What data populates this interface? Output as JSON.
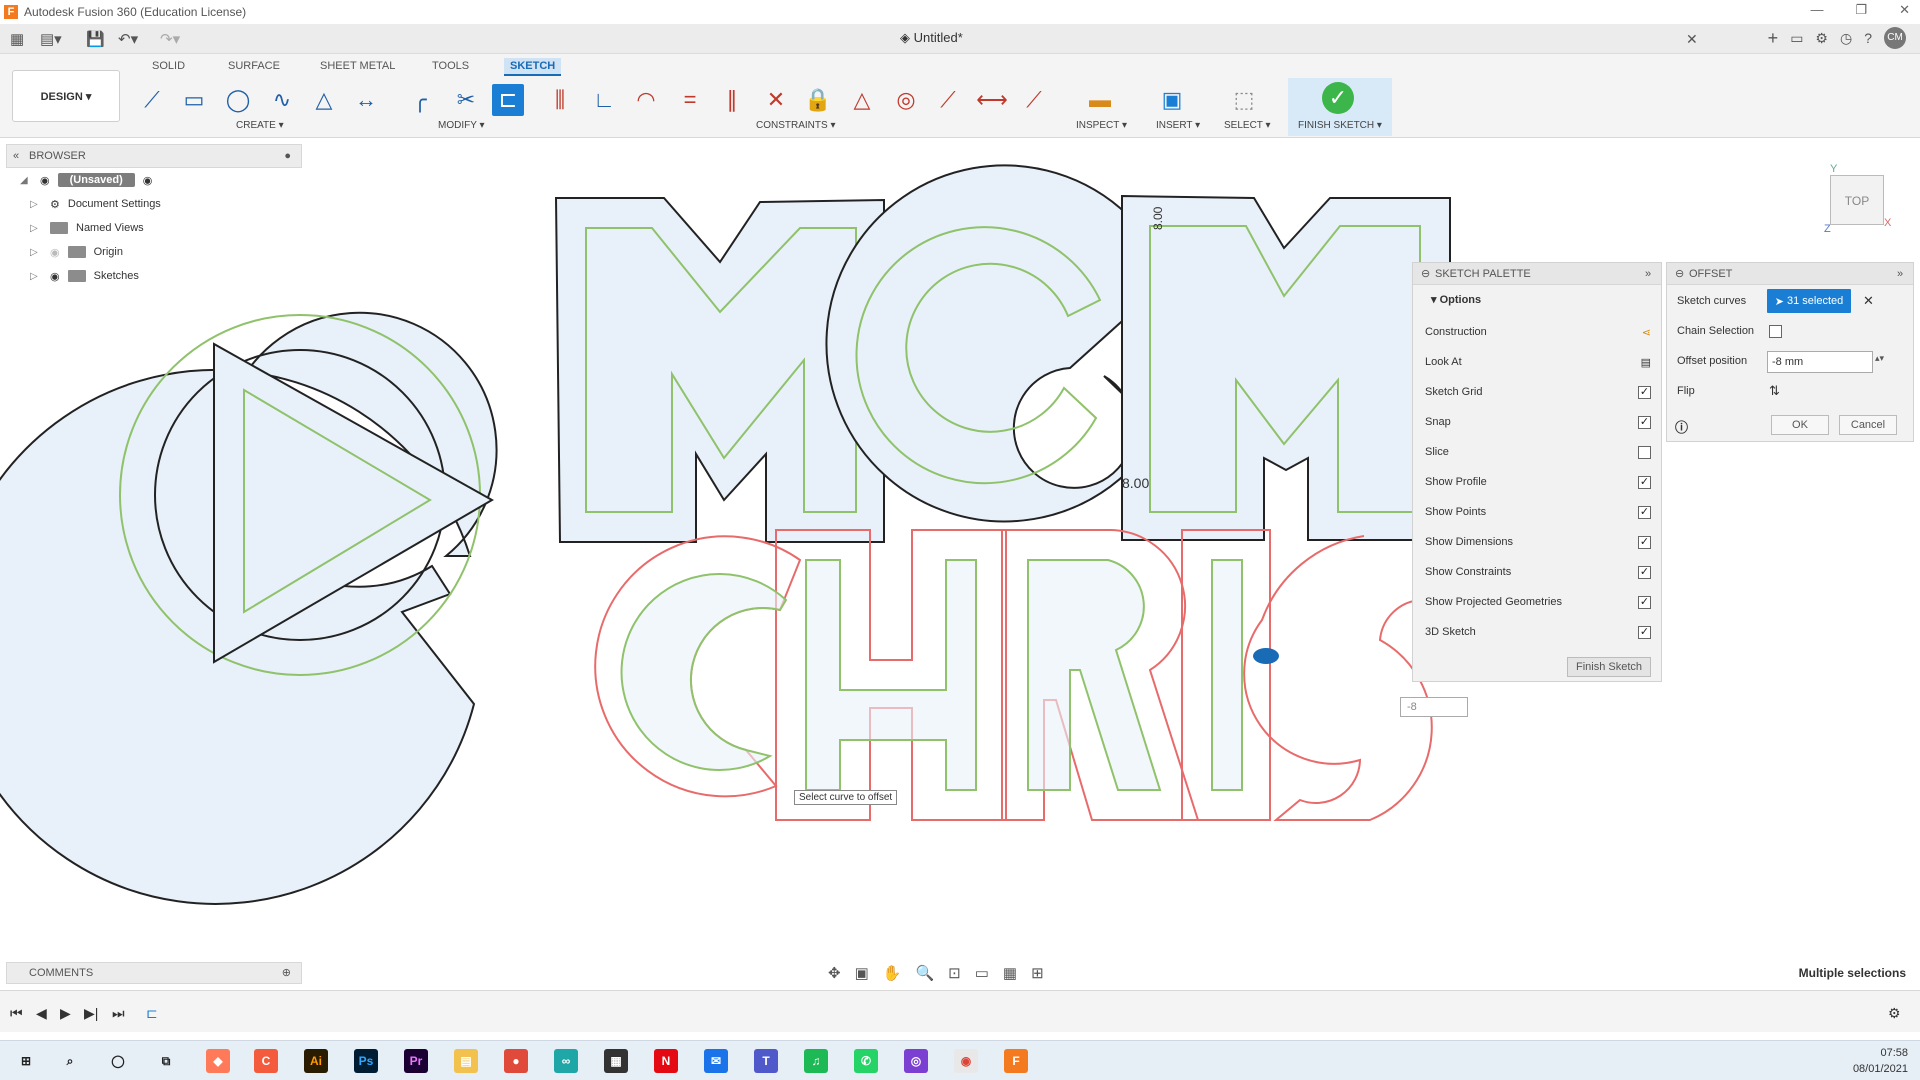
{
  "window": {
    "title": "Autodesk Fusion 360 (Education License)",
    "logo": "F"
  },
  "document": {
    "tab_title": "Untitled*"
  },
  "user": {
    "initials": "CM"
  },
  "ribbon": {
    "tabs": [
      "SOLID",
      "SURFACE",
      "SHEET METAL",
      "TOOLS",
      "SKETCH"
    ],
    "active_tab": "SKETCH",
    "workspace": "DESIGN ▾",
    "groups": [
      "CREATE ▾",
      "MODIFY ▾",
      "CONSTRAINTS ▾",
      "INSPECT ▾",
      "INSERT ▾",
      "SELECT ▾",
      "FINISH SKETCH ▾"
    ]
  },
  "browser": {
    "header": "BROWSER",
    "root": "(Unsaved)",
    "items": [
      "Document Settings",
      "Named Views",
      "Origin",
      "Sketches"
    ]
  },
  "viewcube": {
    "face": "TOP",
    "axis_y": "Y",
    "axis_x": "X",
    "axis_z": "Z"
  },
  "sketch_palette": {
    "header": "SKETCH PALETTE",
    "section": "Options",
    "options": [
      {
        "label": "Construction",
        "control": "icon"
      },
      {
        "label": "Look At",
        "control": "icon"
      },
      {
        "label": "Sketch Grid",
        "checked": true
      },
      {
        "label": "Snap",
        "checked": true
      },
      {
        "label": "Slice",
        "checked": false
      },
      {
        "label": "Show Profile",
        "checked": true
      },
      {
        "label": "Show Points",
        "checked": true
      },
      {
        "label": "Show Dimensions",
        "checked": true
      },
      {
        "label": "Show Constraints",
        "checked": true
      },
      {
        "label": "Show Projected Geometries",
        "checked": true
      },
      {
        "label": "3D Sketch",
        "checked": true
      }
    ],
    "finish_button": "Finish Sketch"
  },
  "offset_dialog": {
    "header": "OFFSET",
    "sketch_curves_label": "Sketch curves",
    "selected_label": "31 selected",
    "chain_selection_label": "Chain Selection",
    "offset_position_label": "Offset position",
    "offset_position_value": "-8 mm",
    "flip_label": "Flip",
    "ok_label": "OK",
    "cancel_label": "Cancel"
  },
  "canvas": {
    "tooltip": "Select curve to offset",
    "dimension_value": "8.00",
    "dimension_value_rotated": "8.00",
    "mini_input_value": "-8"
  },
  "comments": {
    "label": "COMMENTS"
  },
  "status": {
    "multi_selection": "Multiple selections"
  },
  "taskbar": {
    "time": "07:58",
    "date": "08/01/2021"
  },
  "colors": {
    "accent": "#1a7fd4",
    "profile_fill": "#e8f1f9",
    "offset_red": "#e86b6b",
    "offset_green": "#8fc26b"
  }
}
